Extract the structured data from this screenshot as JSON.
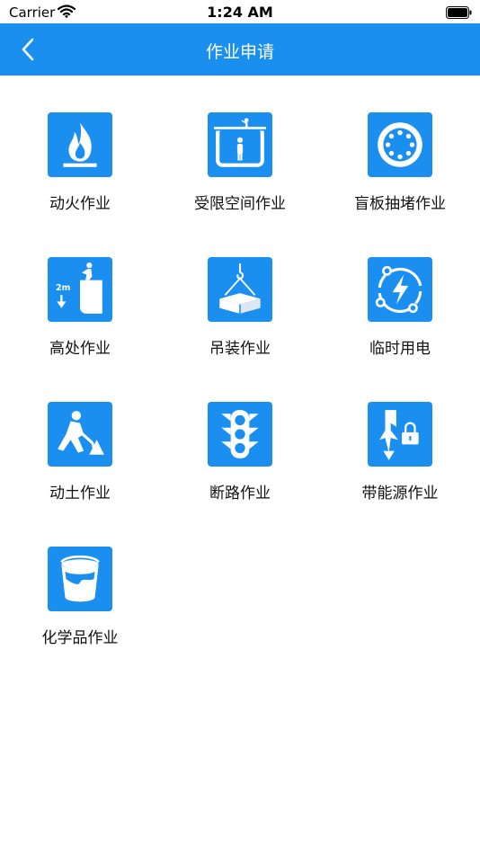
{
  "status": {
    "carrier": "Carrier",
    "time": "1:24 AM"
  },
  "nav": {
    "title": "作业申请"
  },
  "items": [
    {
      "label": "动火作业",
      "icon": "fire-icon"
    },
    {
      "label": "受限空间作业",
      "icon": "confined-space-icon"
    },
    {
      "label": "盲板抽堵作业",
      "icon": "blind-plate-icon"
    },
    {
      "label": "高处作业",
      "icon": "height-work-icon"
    },
    {
      "label": "吊装作业",
      "icon": "hoisting-icon"
    },
    {
      "label": "临时用电",
      "icon": "temporary-power-icon"
    },
    {
      "label": "动土作业",
      "icon": "excavation-icon"
    },
    {
      "label": "断路作业",
      "icon": "traffic-light-icon"
    },
    {
      "label": "带能源作业",
      "icon": "energy-lockout-icon"
    },
    {
      "label": "化学品作业",
      "icon": "chemical-bucket-icon"
    }
  ],
  "icon_text": {
    "height_marker": "2m"
  },
  "colors": {
    "accent": "#1b8ff0",
    "tile": "#1b8ff0"
  }
}
